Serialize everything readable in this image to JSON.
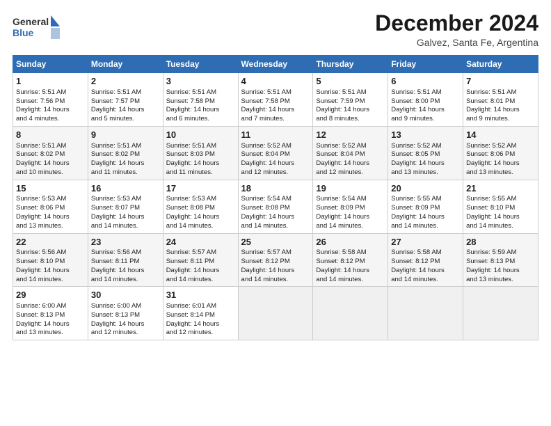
{
  "logo": {
    "general": "General",
    "blue": "Blue"
  },
  "title": "December 2024",
  "location": "Galvez, Santa Fe, Argentina",
  "days_header": [
    "Sunday",
    "Monday",
    "Tuesday",
    "Wednesday",
    "Thursday",
    "Friday",
    "Saturday"
  ],
  "weeks": [
    [
      {
        "day": "1",
        "lines": [
          "Sunrise: 5:51 AM",
          "Sunset: 7:56 PM",
          "Daylight: 14 hours",
          "and 4 minutes."
        ]
      },
      {
        "day": "2",
        "lines": [
          "Sunrise: 5:51 AM",
          "Sunset: 7:57 PM",
          "Daylight: 14 hours",
          "and 5 minutes."
        ]
      },
      {
        "day": "3",
        "lines": [
          "Sunrise: 5:51 AM",
          "Sunset: 7:58 PM",
          "Daylight: 14 hours",
          "and 6 minutes."
        ]
      },
      {
        "day": "4",
        "lines": [
          "Sunrise: 5:51 AM",
          "Sunset: 7:58 PM",
          "Daylight: 14 hours",
          "and 7 minutes."
        ]
      },
      {
        "day": "5",
        "lines": [
          "Sunrise: 5:51 AM",
          "Sunset: 7:59 PM",
          "Daylight: 14 hours",
          "and 8 minutes."
        ]
      },
      {
        "day": "6",
        "lines": [
          "Sunrise: 5:51 AM",
          "Sunset: 8:00 PM",
          "Daylight: 14 hours",
          "and 9 minutes."
        ]
      },
      {
        "day": "7",
        "lines": [
          "Sunrise: 5:51 AM",
          "Sunset: 8:01 PM",
          "Daylight: 14 hours",
          "and 9 minutes."
        ]
      }
    ],
    [
      {
        "day": "8",
        "lines": [
          "Sunrise: 5:51 AM",
          "Sunset: 8:02 PM",
          "Daylight: 14 hours",
          "and 10 minutes."
        ]
      },
      {
        "day": "9",
        "lines": [
          "Sunrise: 5:51 AM",
          "Sunset: 8:02 PM",
          "Daylight: 14 hours",
          "and 11 minutes."
        ]
      },
      {
        "day": "10",
        "lines": [
          "Sunrise: 5:51 AM",
          "Sunset: 8:03 PM",
          "Daylight: 14 hours",
          "and 11 minutes."
        ]
      },
      {
        "day": "11",
        "lines": [
          "Sunrise: 5:52 AM",
          "Sunset: 8:04 PM",
          "Daylight: 14 hours",
          "and 12 minutes."
        ]
      },
      {
        "day": "12",
        "lines": [
          "Sunrise: 5:52 AM",
          "Sunset: 8:04 PM",
          "Daylight: 14 hours",
          "and 12 minutes."
        ]
      },
      {
        "day": "13",
        "lines": [
          "Sunrise: 5:52 AM",
          "Sunset: 8:05 PM",
          "Daylight: 14 hours",
          "and 13 minutes."
        ]
      },
      {
        "day": "14",
        "lines": [
          "Sunrise: 5:52 AM",
          "Sunset: 8:06 PM",
          "Daylight: 14 hours",
          "and 13 minutes."
        ]
      }
    ],
    [
      {
        "day": "15",
        "lines": [
          "Sunrise: 5:53 AM",
          "Sunset: 8:06 PM",
          "Daylight: 14 hours",
          "and 13 minutes."
        ]
      },
      {
        "day": "16",
        "lines": [
          "Sunrise: 5:53 AM",
          "Sunset: 8:07 PM",
          "Daylight: 14 hours",
          "and 14 minutes."
        ]
      },
      {
        "day": "17",
        "lines": [
          "Sunrise: 5:53 AM",
          "Sunset: 8:08 PM",
          "Daylight: 14 hours",
          "and 14 minutes."
        ]
      },
      {
        "day": "18",
        "lines": [
          "Sunrise: 5:54 AM",
          "Sunset: 8:08 PM",
          "Daylight: 14 hours",
          "and 14 minutes."
        ]
      },
      {
        "day": "19",
        "lines": [
          "Sunrise: 5:54 AM",
          "Sunset: 8:09 PM",
          "Daylight: 14 hours",
          "and 14 minutes."
        ]
      },
      {
        "day": "20",
        "lines": [
          "Sunrise: 5:55 AM",
          "Sunset: 8:09 PM",
          "Daylight: 14 hours",
          "and 14 minutes."
        ]
      },
      {
        "day": "21",
        "lines": [
          "Sunrise: 5:55 AM",
          "Sunset: 8:10 PM",
          "Daylight: 14 hours",
          "and 14 minutes."
        ]
      }
    ],
    [
      {
        "day": "22",
        "lines": [
          "Sunrise: 5:56 AM",
          "Sunset: 8:10 PM",
          "Daylight: 14 hours",
          "and 14 minutes."
        ]
      },
      {
        "day": "23",
        "lines": [
          "Sunrise: 5:56 AM",
          "Sunset: 8:11 PM",
          "Daylight: 14 hours",
          "and 14 minutes."
        ]
      },
      {
        "day": "24",
        "lines": [
          "Sunrise: 5:57 AM",
          "Sunset: 8:11 PM",
          "Daylight: 14 hours",
          "and 14 minutes."
        ]
      },
      {
        "day": "25",
        "lines": [
          "Sunrise: 5:57 AM",
          "Sunset: 8:12 PM",
          "Daylight: 14 hours",
          "and 14 minutes."
        ]
      },
      {
        "day": "26",
        "lines": [
          "Sunrise: 5:58 AM",
          "Sunset: 8:12 PM",
          "Daylight: 14 hours",
          "and 14 minutes."
        ]
      },
      {
        "day": "27",
        "lines": [
          "Sunrise: 5:58 AM",
          "Sunset: 8:12 PM",
          "Daylight: 14 hours",
          "and 14 minutes."
        ]
      },
      {
        "day": "28",
        "lines": [
          "Sunrise: 5:59 AM",
          "Sunset: 8:13 PM",
          "Daylight: 14 hours",
          "and 13 minutes."
        ]
      }
    ],
    [
      {
        "day": "29",
        "lines": [
          "Sunrise: 6:00 AM",
          "Sunset: 8:13 PM",
          "Daylight: 14 hours",
          "and 13 minutes."
        ]
      },
      {
        "day": "30",
        "lines": [
          "Sunrise: 6:00 AM",
          "Sunset: 8:13 PM",
          "Daylight: 14 hours",
          "and 12 minutes."
        ]
      },
      {
        "day": "31",
        "lines": [
          "Sunrise: 6:01 AM",
          "Sunset: 8:14 PM",
          "Daylight: 14 hours",
          "and 12 minutes."
        ]
      },
      {
        "day": "",
        "lines": []
      },
      {
        "day": "",
        "lines": []
      },
      {
        "day": "",
        "lines": []
      },
      {
        "day": "",
        "lines": []
      }
    ]
  ]
}
